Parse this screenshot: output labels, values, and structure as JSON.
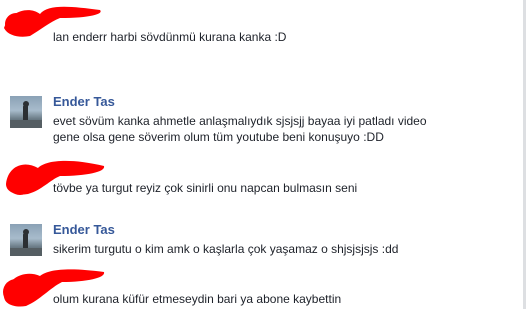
{
  "colors": {
    "name": "#365899",
    "text": "#1d2129",
    "redaction": "#ff0000"
  },
  "comments": [
    {
      "author": "",
      "redacted": true,
      "lines": [
        "lan enderr harbi sövdünmü kurana kanka :D"
      ]
    },
    {
      "author": "Ender Tas",
      "redacted": false,
      "avatar": "avatar-photo",
      "lines": [
        "evet sövüm kanka ahmetle anlaşmalıydık sjsjsjj bayaa iyi patladı video",
        "gene olsa gene söverim olum tüm youtube beni konuşuyo :DD"
      ]
    },
    {
      "author": "",
      "redacted": true,
      "lines": [
        "tövbe ya turgut reyiz çok sinirli onu napcan bulmasın seni"
      ]
    },
    {
      "author": "Ender Tas",
      "redacted": false,
      "avatar": "avatar-photo",
      "lines": [
        "sikerim turgutu o kim amk o kaşlarla çok yaşamaz o shjsjsjsjs :dd"
      ]
    },
    {
      "author": "",
      "redacted": true,
      "lines": [
        "olum kurana küfür etmeseydin bari ya abone kaybettin"
      ]
    }
  ]
}
